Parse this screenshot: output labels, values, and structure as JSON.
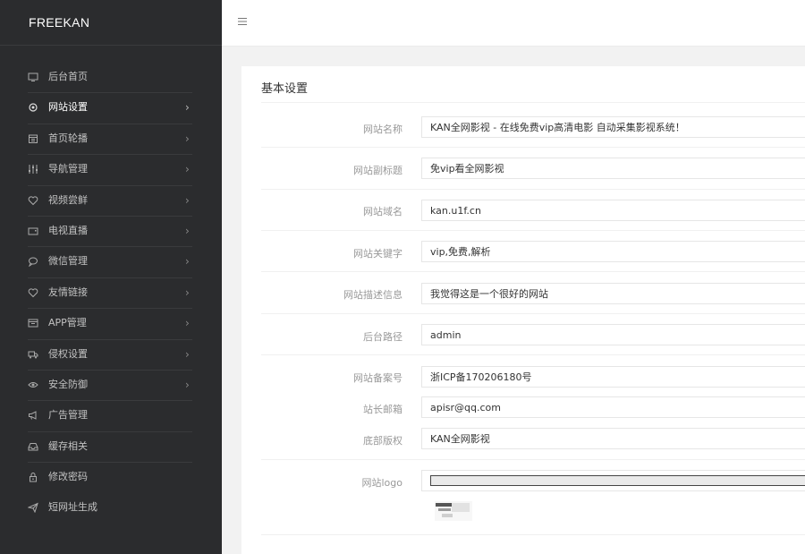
{
  "app": {
    "logo_text": "FREEKAN"
  },
  "topbar": {
    "menu_icon": "hamburger-icon"
  },
  "sidebar": {
    "items": [
      {
        "label": "后台首页",
        "icon": "monitor-icon",
        "has_arrow": false,
        "active": false
      },
      {
        "label": "网站设置",
        "icon": "gear-icon",
        "has_arrow": true,
        "active": true
      },
      {
        "label": "首页轮播",
        "icon": "calendar-icon",
        "has_arrow": true,
        "active": false
      },
      {
        "label": "导航管理",
        "icon": "sliders-icon",
        "has_arrow": true,
        "active": false
      },
      {
        "label": "视频尝鲜",
        "icon": "heart-icon",
        "has_arrow": true,
        "active": false
      },
      {
        "label": "电视直播",
        "icon": "tv-icon",
        "has_arrow": true,
        "active": false
      },
      {
        "label": "微信管理",
        "icon": "chat-icon",
        "has_arrow": true,
        "active": false
      },
      {
        "label": "友情链接",
        "icon": "heart-icon",
        "has_arrow": true,
        "active": false
      },
      {
        "label": "APP管理",
        "icon": "app-icon",
        "has_arrow": true,
        "active": false
      },
      {
        "label": "侵权设置",
        "icon": "truck-icon",
        "has_arrow": true,
        "active": false
      },
      {
        "label": "安全防御",
        "icon": "eye-icon",
        "has_arrow": true,
        "active": false
      },
      {
        "label": "广告管理",
        "icon": "megaphone-icon",
        "has_arrow": false,
        "active": false
      },
      {
        "label": "缓存相关",
        "icon": "inbox-icon",
        "has_arrow": false,
        "active": false
      },
      {
        "label": "修改密码",
        "icon": "lock-icon",
        "has_arrow": false,
        "active": false
      },
      {
        "label": "短网址生成",
        "icon": "send-icon",
        "has_arrow": false,
        "active": false
      }
    ],
    "arrow_glyph": "›"
  },
  "form": {
    "title": "基本设置",
    "fields": {
      "site_name": {
        "label": "网站名称",
        "value": "KAN全网影视 - 在线免费vip高清电影 自动采集影视系统！"
      },
      "site_subtitle": {
        "label": "网站副标题",
        "value": "免vip看全网影视"
      },
      "site_domain": {
        "label": "网站域名",
        "value": "kan.u1f.cn"
      },
      "site_keywords": {
        "label": "网站关键字",
        "value": "vip,免费,解析"
      },
      "site_description": {
        "label": "网站描述信息",
        "value": "我觉得这是一个很好的网站"
      },
      "admin_path": {
        "label": "后台路径",
        "value": "admin"
      },
      "icp_number": {
        "label": "网站备案号",
        "value": "浙ICP备170206180号"
      },
      "admin_email": {
        "label": "站长邮箱",
        "value": "apisr@qq.com"
      },
      "footer_copyright": {
        "label": "底部版权",
        "value": "KAN全网影视"
      },
      "site_logo": {
        "label": "网站logo"
      }
    }
  }
}
